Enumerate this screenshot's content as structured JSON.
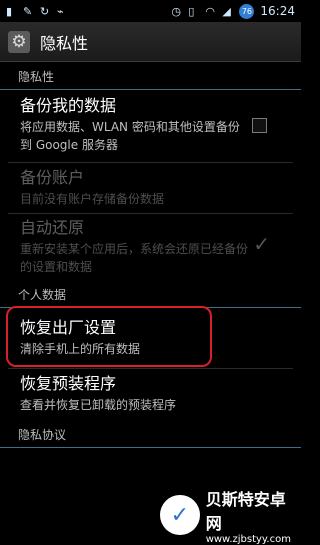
{
  "status_bar": {
    "time": "16:24",
    "battery": "76"
  },
  "header": {
    "title": "隐私性",
    "icon": "gear-icon"
  },
  "sections": {
    "privacy_header": "隐私性",
    "personal_header": "个人数据",
    "agreement_header": "隐私协议"
  },
  "items": {
    "backup": {
      "title": "备份我的数据",
      "summary": "将应用数据、WLAN 密码和其他设置备份到 Google 服务器",
      "checked": false,
      "enabled": true
    },
    "backup_account": {
      "title": "备份账户",
      "summary": "目前没有账户存储备份数据",
      "enabled": false
    },
    "auto_restore": {
      "title": "自动还原",
      "summary": "重新安装某个应用后，系统会还原已经备份的设置和数据",
      "checked": true,
      "enabled": false
    },
    "factory_reset": {
      "title": "恢复出厂设置",
      "summary": "清除手机上的所有数据",
      "highlighted": true
    },
    "restore_preinstalled": {
      "title": "恢复预装程序",
      "summary": "查看并恢复已卸载的预装程序"
    }
  },
  "watermark": {
    "title": "贝斯特安卓网",
    "url": "www.zjbstyy.com"
  },
  "colors": {
    "highlight": "#d6202a",
    "accent": "#2f7fd6"
  }
}
